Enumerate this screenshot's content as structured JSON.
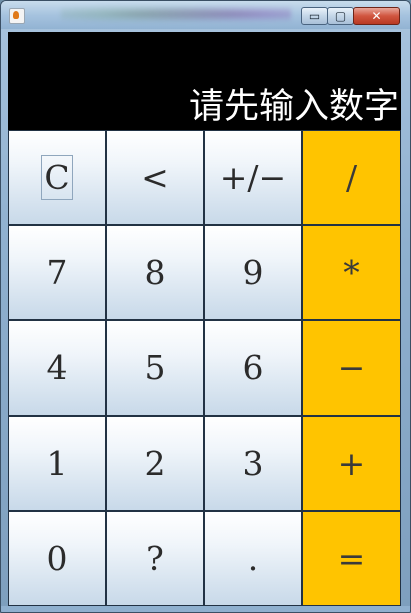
{
  "window": {
    "title": "",
    "controls": {
      "minimize": "▭",
      "maximize": "▢",
      "close": "✕"
    }
  },
  "display": {
    "text": "请先输入数字"
  },
  "keypad": {
    "rows": [
      [
        {
          "label": "C",
          "name": "clear-button",
          "type": "func"
        },
        {
          "label": "<",
          "name": "backspace-button",
          "type": "func"
        },
        {
          "label": "+/−",
          "name": "sign-toggle-button",
          "type": "func"
        },
        {
          "label": "/",
          "name": "divide-button",
          "type": "op"
        }
      ],
      [
        {
          "label": "7",
          "name": "digit-7-button",
          "type": "num"
        },
        {
          "label": "8",
          "name": "digit-8-button",
          "type": "num"
        },
        {
          "label": "9",
          "name": "digit-9-button",
          "type": "num"
        },
        {
          "label": "*",
          "name": "multiply-button",
          "type": "op"
        }
      ],
      [
        {
          "label": "4",
          "name": "digit-4-button",
          "type": "num"
        },
        {
          "label": "5",
          "name": "digit-5-button",
          "type": "num"
        },
        {
          "label": "6",
          "name": "digit-6-button",
          "type": "num"
        },
        {
          "label": "−",
          "name": "subtract-button",
          "type": "op"
        }
      ],
      [
        {
          "label": "1",
          "name": "digit-1-button",
          "type": "num"
        },
        {
          "label": "2",
          "name": "digit-2-button",
          "type": "num"
        },
        {
          "label": "3",
          "name": "digit-3-button",
          "type": "num"
        },
        {
          "label": "+",
          "name": "add-button",
          "type": "op"
        }
      ],
      [
        {
          "label": "0",
          "name": "digit-0-button",
          "type": "num"
        },
        {
          "label": "?",
          "name": "unknown-button",
          "type": "num"
        },
        {
          "label": ".",
          "name": "decimal-button",
          "type": "num"
        },
        {
          "label": "=",
          "name": "equals-button",
          "type": "op"
        }
      ]
    ]
  },
  "colors": {
    "display_bg": "#000000",
    "display_text": "#ffffff",
    "operator_key_bg": "#ffc400",
    "key_gradient_bottom": "#c8d9e9"
  }
}
